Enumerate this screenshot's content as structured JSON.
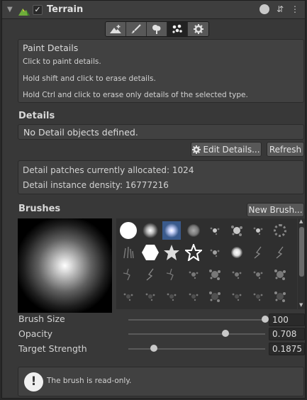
{
  "header": {
    "title": "Terrain",
    "enabled_mark": "✓",
    "help_glyph": "?",
    "settings_glyph": "⇵",
    "menu_glyph": "⋮"
  },
  "toolbar": {
    "tools": [
      "raise-lower",
      "paint-texture",
      "paint-trees",
      "paint-details",
      "settings"
    ],
    "active_index": 3
  },
  "paint_details": {
    "title": "Paint Details",
    "line1": "Click to paint details.",
    "line2": "Hold shift and click to erase details.",
    "line3": "Hold Ctrl and click to erase only details of the selected type."
  },
  "details": {
    "heading": "Details",
    "empty_message": "No Detail objects defined.",
    "edit_button": "Edit Details...",
    "refresh_button": "Refresh"
  },
  "stats": {
    "patches": "Detail patches currently allocated: 1024",
    "density": "Detail instance density: 16777216"
  },
  "brushes": {
    "heading": "Brushes",
    "new_button": "New Brush...",
    "selected_index": 2
  },
  "settings": {
    "brush_size_label": "Brush Size",
    "brush_size_value": "100",
    "brush_size_fraction": 1.0,
    "opacity_label": "Opacity",
    "opacity_value": "0.708",
    "opacity_fraction": 0.708,
    "strength_label": "Target Strength",
    "strength_value": "0.1875",
    "strength_fraction": 0.1875
  },
  "notice": {
    "text": "The brush is read-only.",
    "icon_glyph": "!"
  },
  "colors": {
    "panel": "#383838",
    "accent_selected": "#3a5a8c"
  }
}
